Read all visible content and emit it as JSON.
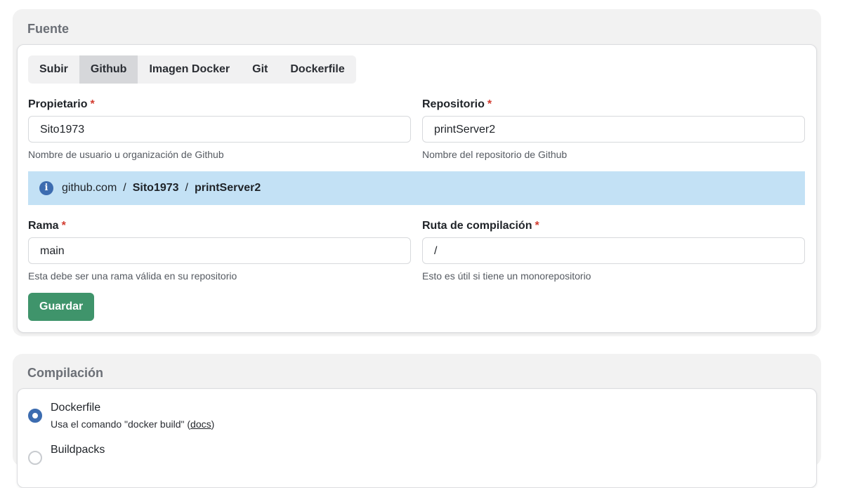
{
  "source": {
    "title": "Fuente",
    "tabs": [
      "Subir",
      "Github",
      "Imagen Docker",
      "Git",
      "Dockerfile"
    ],
    "active_tab": "Github",
    "owner": {
      "label": "Propietario",
      "required": "*",
      "value": "Sito1973",
      "help": "Nombre de usuario u organización de Github"
    },
    "repo": {
      "label": "Repositorio",
      "required": "*",
      "value": "printServer2",
      "help": "Nombre del repositorio de Github"
    },
    "info": {
      "host": "github.com",
      "sep": "/",
      "owner": "Sito1973",
      "repo": "printServer2"
    },
    "branch": {
      "label": "Rama",
      "required": "*",
      "value": "main",
      "help": "Esta debe ser una rama válida en su repositorio"
    },
    "build_path": {
      "label": "Ruta de compilación",
      "required": "*",
      "value": "/",
      "help": "Esto es útil si tiene un monorepositorio"
    },
    "save_label": "Guardar"
  },
  "build": {
    "title": "Compilación",
    "options": [
      {
        "title": "Dockerfile",
        "desc_prefix": "Usa el comando \"docker build\" (",
        "link": "docs",
        "desc_suffix": ")",
        "selected": true
      },
      {
        "title": "Buildpacks",
        "selected": false
      }
    ]
  },
  "colors": {
    "accent": "#3c6cb0",
    "save": "#3f946b",
    "info_bg": "#c3e1f5",
    "required": "#d23b2f"
  }
}
